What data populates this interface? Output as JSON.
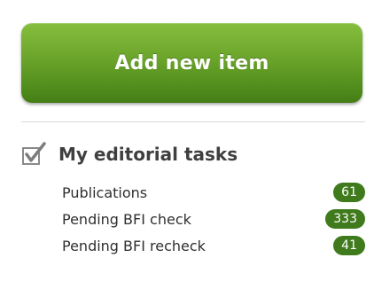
{
  "add_button": {
    "label": "Add new item"
  },
  "editorial_tasks": {
    "title": "My editorial tasks",
    "icon": "checkbox-checked-icon",
    "items": [
      {
        "label": "Publications",
        "count": "61"
      },
      {
        "label": "Pending BFI check",
        "count": "333"
      },
      {
        "label": "Pending BFI recheck",
        "count": "41"
      }
    ]
  },
  "colors": {
    "button_top": "#86bf3e",
    "button_bottom": "#447d16",
    "badge": "#3f7a1c",
    "text": "#2f2f2f"
  }
}
